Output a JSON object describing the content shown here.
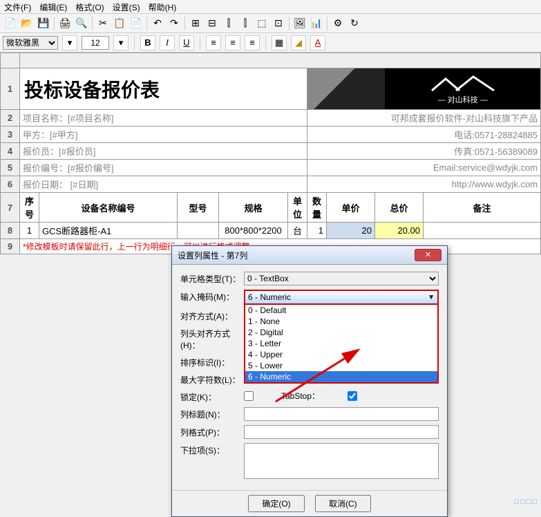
{
  "menu": {
    "file": "文件(F)",
    "edit": "编辑(E)",
    "format": "格式(O)",
    "settings": "设置(S)",
    "help": "帮助(H)"
  },
  "font": {
    "name": "微软雅黑",
    "size": "12"
  },
  "sheet": {
    "title": "投标设备报价表",
    "logo_text": "— 对山科技 —",
    "rows": {
      "r2": "项目名称：[#项目名称]",
      "r2r": "可邦成套报价软件-对山科技旗下产品",
      "r3": "甲方：[#甲方]",
      "r3r": "电话:0571-28824885",
      "r4": "报价员：[#报价员]",
      "r4r": "传真:0571-56389089",
      "r5": "报价编号：[#报价编号]",
      "r5r": "Email:service@wdyjk.com",
      "r6": "报价日期： [#日期]",
      "r6r": "http://www.wdyjk.com"
    },
    "headers": {
      "seq": "序号",
      "name": "设备名称编号",
      "model": "型号",
      "spec": "规格",
      "unit": "单位",
      "qty": "数量",
      "price": "单价",
      "total": "总价",
      "remark": "备注"
    },
    "data": {
      "seq": "1",
      "name": "GCS断路器柜-A1",
      "model": "",
      "spec": "800*800*2200",
      "unit": "台",
      "qty": "1",
      "price": "20",
      "total": "20.00",
      "remark": ""
    },
    "note": "*修改模板时请保留此行，上一行为明细行，可以进行格式调整。"
  },
  "dialog": {
    "title": "设置列属性 - 第7列",
    "cell_type_label": "单元格类型(T)：",
    "cell_type_value": "0 - TextBox",
    "mask_label": "输入掩码(M)：",
    "mask_value": "6 - Numeric",
    "mask_options": [
      "0 - Default",
      "1 - None",
      "2 - Digital",
      "3 - Letter",
      "4 - Upper",
      "5 - Lower",
      "6 - Numeric"
    ],
    "align_label": "对齐方式(A)：",
    "header_align_label": "列头对齐方式(H)：",
    "sort_label": "排序标识(I)：",
    "maxlen_label": "最大字符数(L)：",
    "lock_label": "锁定(K)：",
    "tabstop_label": "TabStop：",
    "col_title_label": "列标题(N)：",
    "col_format_label": "列格式(P)：",
    "dropdown_label": "下拉项(S)：",
    "ok": "确定(O)",
    "cancel": "取消(C)"
  },
  "status": "□□□□"
}
